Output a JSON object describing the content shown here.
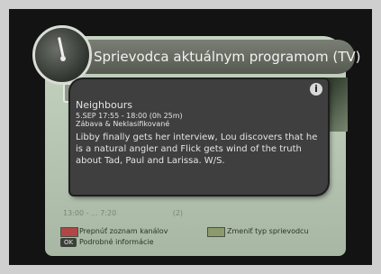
{
  "header": {
    "title": "Sprievodca aktuálnym programom (TV)"
  },
  "under": {
    "partial_time": "13:00 - ... 7:20",
    "partial_mark": "(2)"
  },
  "popup": {
    "program_title": "Neighbours",
    "time_line": "5.SEP 17:55 - 18:00 (0h 25m)",
    "genre_line": "Zábava & Neklasifikované",
    "description": "Libby finally gets her interview, Lou discovers that he is a natural angler and Flick gets wind of the truth about Tad, Paul and Larissa. W/S.",
    "info_icon": "i"
  },
  "legend": {
    "red_label": "Prepnúť zoznam kanálov",
    "green_label": "Zmeniť typ sprievodcu",
    "ok_key": "OK",
    "ok_label": "Podrobné informácie",
    "colors": {
      "red": "#b04646",
      "green": "#8c9b6e"
    }
  }
}
